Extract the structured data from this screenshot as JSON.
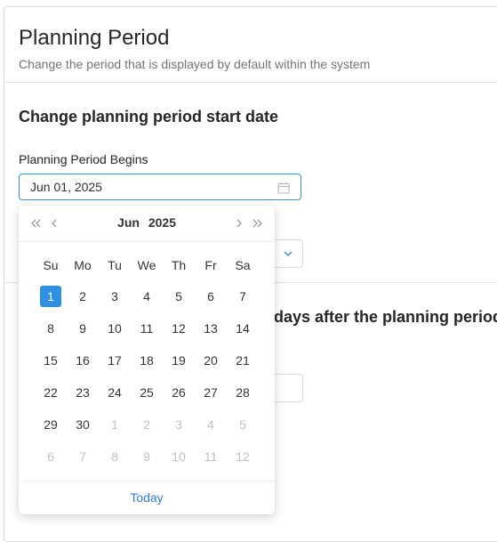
{
  "header": {
    "title": "Planning Period",
    "subtitle": "Change the period that is displayed by default within the system"
  },
  "start_section": {
    "title": "Change planning period start date",
    "field_label": "Planning Period Begins",
    "field_value": "Jun 01, 2025"
  },
  "second_section": {
    "title_partial": "days after the planning period"
  },
  "datepicker": {
    "month": "Jun",
    "year": "2025",
    "weekdays": [
      "Su",
      "Mo",
      "Tu",
      "We",
      "Th",
      "Fr",
      "Sa"
    ],
    "weeks": [
      [
        {
          "d": "1",
          "m": false,
          "s": true
        },
        {
          "d": "2",
          "m": false
        },
        {
          "d": "3",
          "m": false
        },
        {
          "d": "4",
          "m": false
        },
        {
          "d": "5",
          "m": false
        },
        {
          "d": "6",
          "m": false
        },
        {
          "d": "7",
          "m": false
        }
      ],
      [
        {
          "d": "8",
          "m": false
        },
        {
          "d": "9",
          "m": false
        },
        {
          "d": "10",
          "m": false
        },
        {
          "d": "11",
          "m": false
        },
        {
          "d": "12",
          "m": false
        },
        {
          "d": "13",
          "m": false
        },
        {
          "d": "14",
          "m": false
        }
      ],
      [
        {
          "d": "15",
          "m": false
        },
        {
          "d": "16",
          "m": false
        },
        {
          "d": "17",
          "m": false
        },
        {
          "d": "18",
          "m": false
        },
        {
          "d": "19",
          "m": false
        },
        {
          "d": "20",
          "m": false
        },
        {
          "d": "21",
          "m": false
        }
      ],
      [
        {
          "d": "22",
          "m": false
        },
        {
          "d": "23",
          "m": false
        },
        {
          "d": "24",
          "m": false
        },
        {
          "d": "25",
          "m": false
        },
        {
          "d": "26",
          "m": false
        },
        {
          "d": "27",
          "m": false
        },
        {
          "d": "28",
          "m": false
        }
      ],
      [
        {
          "d": "29",
          "m": false
        },
        {
          "d": "30",
          "m": false
        },
        {
          "d": "1",
          "m": true
        },
        {
          "d": "2",
          "m": true
        },
        {
          "d": "3",
          "m": true
        },
        {
          "d": "4",
          "m": true
        },
        {
          "d": "5",
          "m": true
        }
      ],
      [
        {
          "d": "6",
          "m": true
        },
        {
          "d": "7",
          "m": true
        },
        {
          "d": "8",
          "m": true
        },
        {
          "d": "9",
          "m": true
        },
        {
          "d": "10",
          "m": true
        },
        {
          "d": "11",
          "m": true
        },
        {
          "d": "12",
          "m": true
        }
      ]
    ],
    "today_label": "Today"
  },
  "icons": {
    "calendar": "calendar-icon",
    "chevron_down": "chevron-down-icon",
    "prev_year": "double-chevron-left-icon",
    "prev_month": "chevron-left-icon",
    "next_month": "chevron-right-icon",
    "next_year": "double-chevron-right-icon"
  },
  "colors": {
    "accent": "#2f8fe0",
    "focus_border": "#3e8ed0",
    "link": "#2f80d9",
    "muted_text": "#c0c0c0"
  }
}
